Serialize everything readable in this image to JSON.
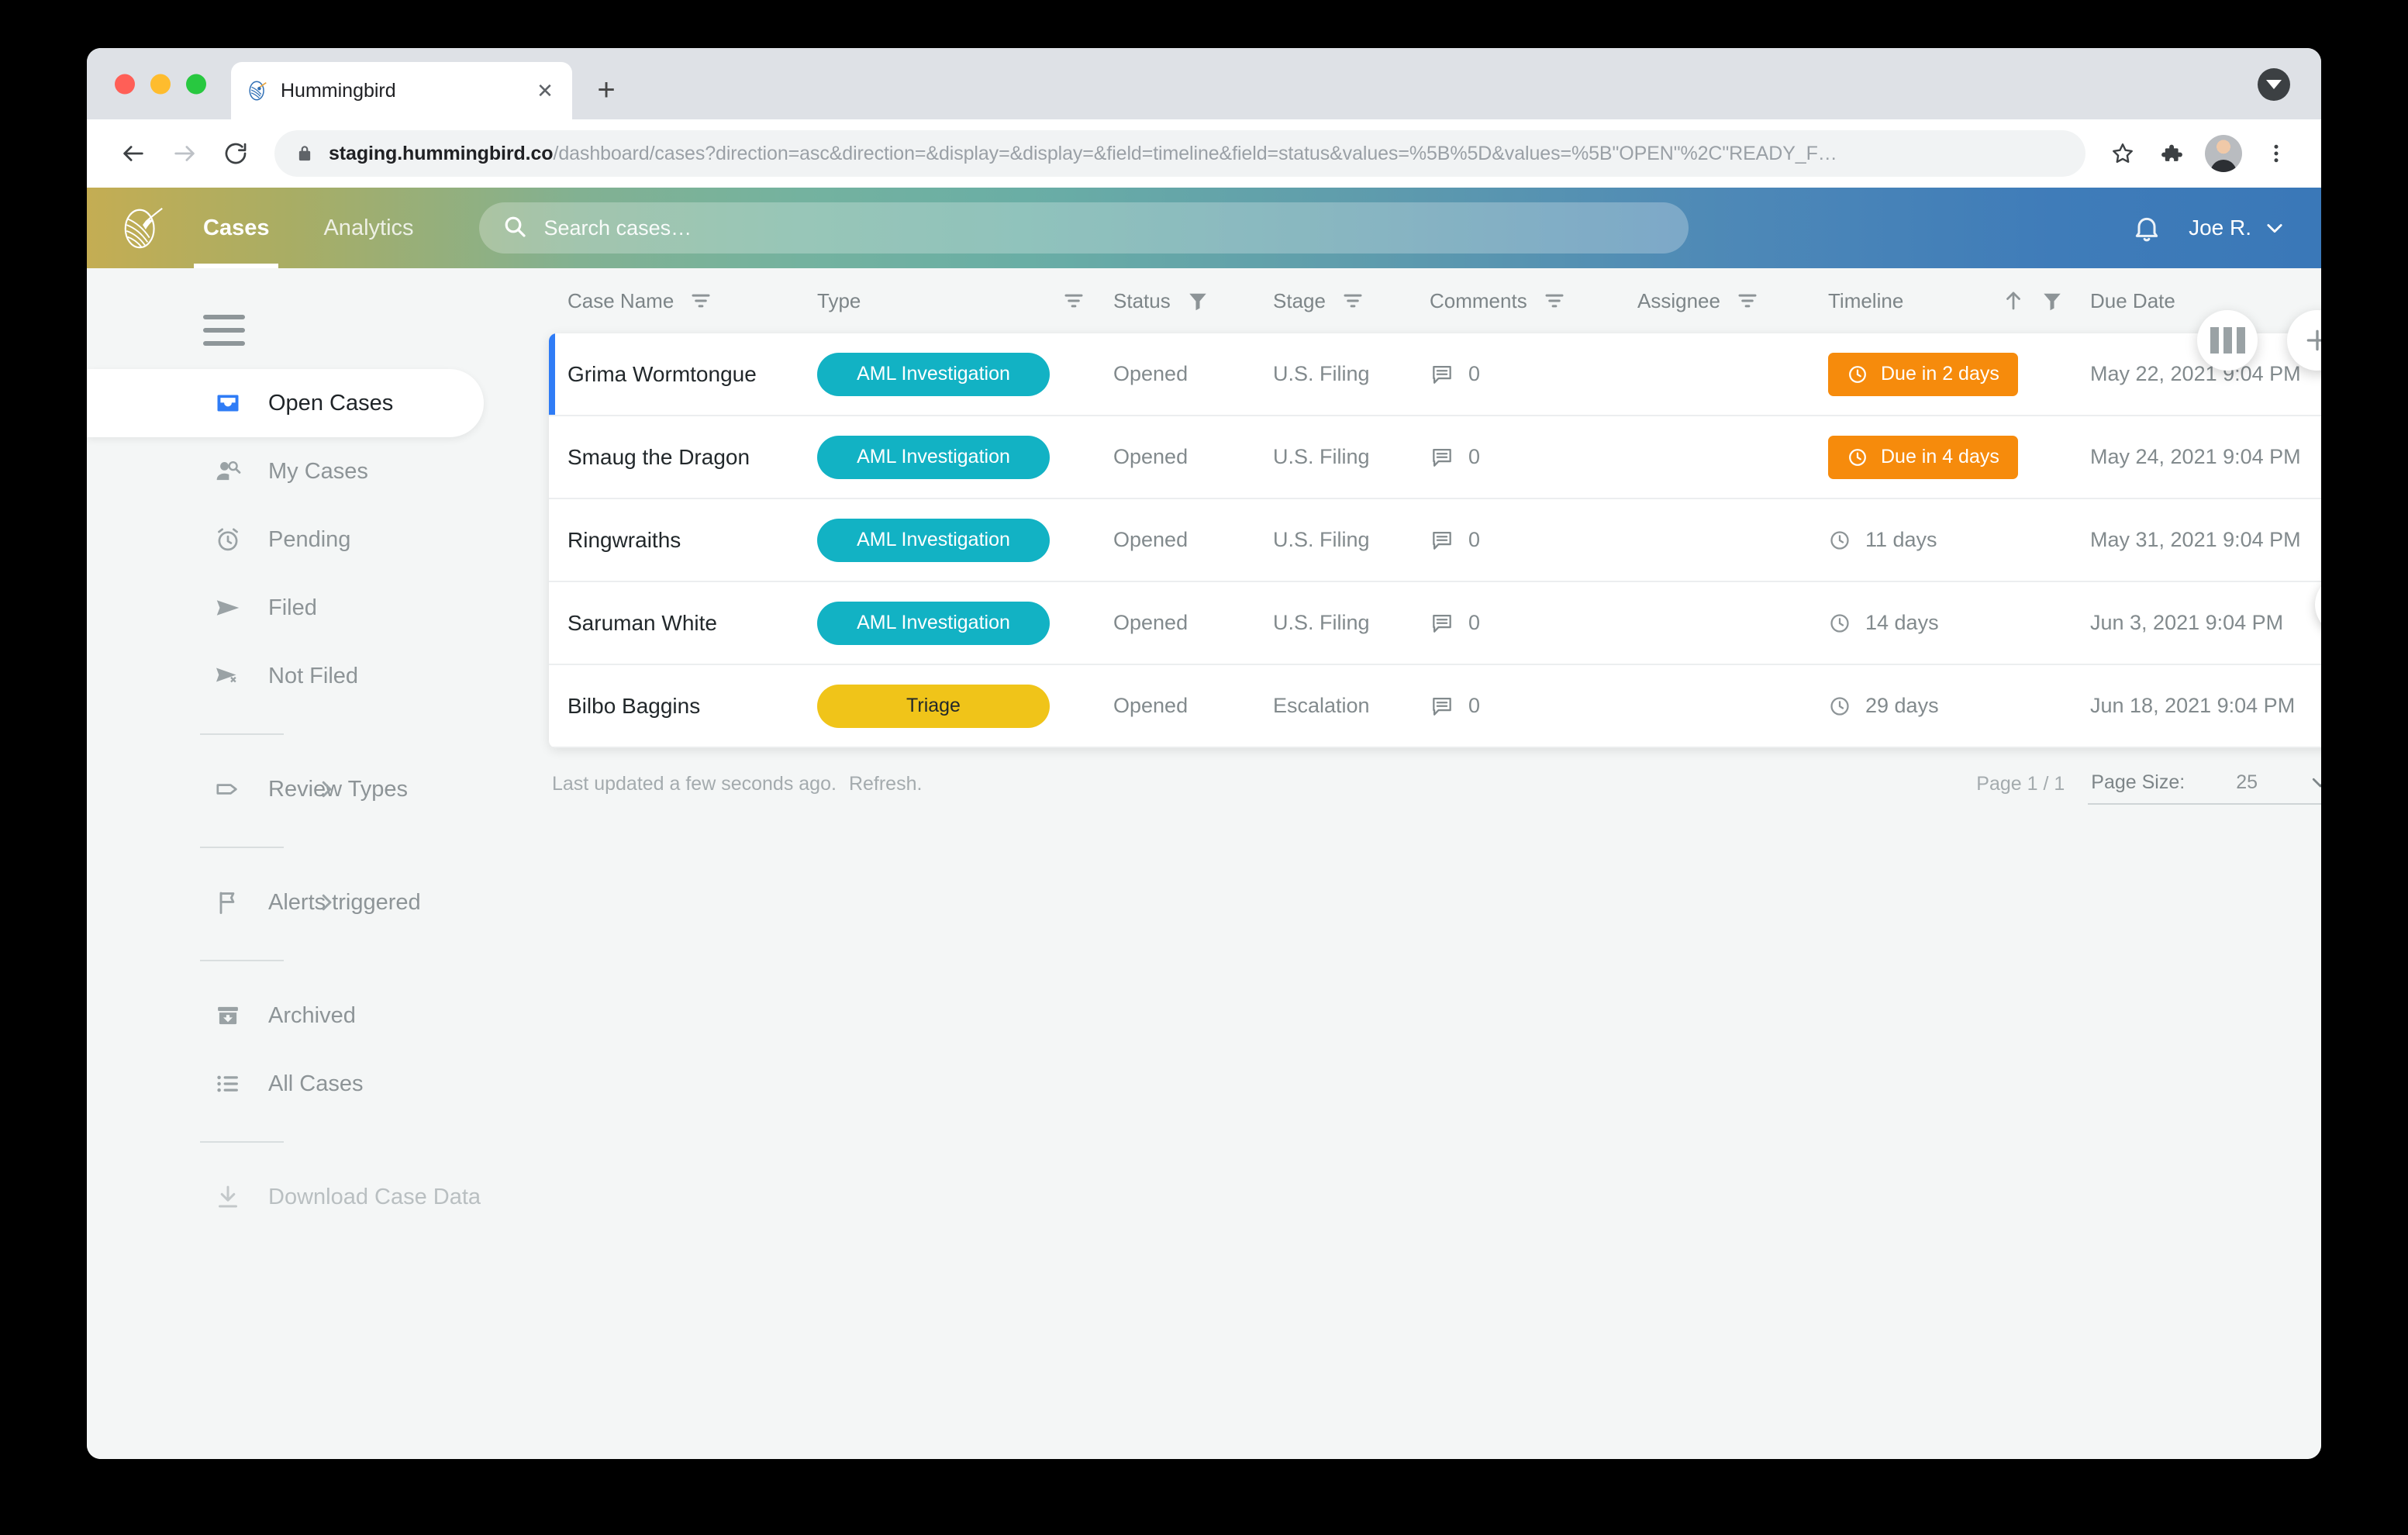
{
  "browser": {
    "tab": {
      "title": "Hummingbird",
      "favicon_icon": "hummingbird-favicon",
      "close_icon": "close-icon"
    },
    "new_tab_icon": "plus-icon",
    "tabstrip_menu_icon": "chevron-down-circle-icon",
    "back_icon": "arrow-left-icon",
    "forward_icon": "arrow-right-icon",
    "reload_icon": "reload-icon",
    "lock_icon": "lock-icon",
    "url_domain": "staging.hummingbird.co",
    "url_path": "/dashboard/cases?direction=asc&direction=&display=&display=&field=timeline&field=status&values=%5B%5D&values=%5B\"OPEN\"%2C\"READY_F…",
    "bookmark_icon": "star-icon",
    "extensions_icon": "puzzle-piece-icon",
    "avatar_name": "profile-avatar",
    "menu_icon": "three-dot-menu-icon"
  },
  "header": {
    "logo_icon": "hummingbird-logo",
    "nav": [
      {
        "label": "Cases",
        "active": true
      },
      {
        "label": "Analytics",
        "active": false
      }
    ],
    "search": {
      "placeholder": "Search cases…",
      "value": "",
      "icon": "search-icon"
    },
    "bell_icon": "bell-icon",
    "user": {
      "label": "Joe R.",
      "caret_icon": "chevron-down-icon"
    }
  },
  "sidebar": {
    "hamburger_icon": "hamburger-icon",
    "items": [
      {
        "label": "Open Cases",
        "icon": "inbox-icon",
        "active": true,
        "muted": false,
        "chevron": false
      },
      {
        "label": "My Cases",
        "icon": "person-search-icon",
        "active": false,
        "muted": false,
        "chevron": false
      },
      {
        "label": "Pending",
        "icon": "alarm-clock-icon",
        "active": false,
        "muted": false,
        "chevron": false
      },
      {
        "label": "Filed",
        "icon": "send-icon",
        "active": false,
        "muted": false,
        "chevron": false
      },
      {
        "label": "Not Filed",
        "icon": "send-off-icon",
        "active": false,
        "muted": false,
        "chevron": false
      },
      {
        "label": "Review Types",
        "icon": "tag-icon",
        "active": false,
        "muted": false,
        "chevron": true
      },
      {
        "label": "Alerts triggered",
        "icon": "flag-icon",
        "active": false,
        "muted": false,
        "chevron": true
      },
      {
        "label": "Archived",
        "icon": "archive-icon",
        "active": false,
        "muted": false,
        "chevron": false
      },
      {
        "label": "All Cases",
        "icon": "list-icon",
        "active": false,
        "muted": false,
        "chevron": false
      },
      {
        "label": "Download Case Data",
        "icon": "download-icon",
        "active": false,
        "muted": true,
        "chevron": false
      }
    ]
  },
  "fabs": [
    {
      "name": "columns-button",
      "icon": "columns-icon"
    },
    {
      "name": "add-case-button",
      "icon": "plus-icon"
    }
  ],
  "table": {
    "columns": [
      {
        "key": "name",
        "label": "Case Name",
        "filter": "outline",
        "sort": "none"
      },
      {
        "key": "type",
        "label": "Type",
        "filter": "outline",
        "sort": "none"
      },
      {
        "key": "status",
        "label": "Status",
        "filter": "active",
        "sort": "none"
      },
      {
        "key": "stage",
        "label": "Stage",
        "filter": "outline",
        "sort": "none"
      },
      {
        "key": "comments",
        "label": "Comments",
        "filter": "outline",
        "sort": "none"
      },
      {
        "key": "assignee",
        "label": "Assignee",
        "filter": "outline",
        "sort": "none"
      },
      {
        "key": "timeline",
        "label": "Timeline",
        "filter": "active",
        "sort": "asc"
      },
      {
        "key": "due",
        "label": "Due Date",
        "filter": "outline",
        "sort": "none"
      }
    ],
    "rows": [
      {
        "selected": true,
        "name": "Grima Wormtongue",
        "type": "AML Investigation",
        "type_color": "#12b2c4",
        "status": "Opened",
        "stage": "U.S. Filing",
        "comments": "0",
        "assignee": "",
        "timeline": "Due in 2 days",
        "timeline_style": "badge",
        "timeline_color": "#f68b0c",
        "due": "May 22, 2021 9:04 PM"
      },
      {
        "selected": false,
        "name": "Smaug the Dragon",
        "type": "AML Investigation",
        "type_color": "#12b2c4",
        "status": "Opened",
        "stage": "U.S. Filing",
        "comments": "0",
        "assignee": "",
        "timeline": "Due in 4 days",
        "timeline_style": "badge",
        "timeline_color": "#f68b0c",
        "due": "May 24, 2021 9:04 PM"
      },
      {
        "selected": false,
        "name": "Ringwraiths",
        "type": "AML Investigation",
        "type_color": "#12b2c4",
        "status": "Opened",
        "stage": "U.S. Filing",
        "comments": "0",
        "assignee": "",
        "timeline": "11 days",
        "timeline_style": "plain",
        "timeline_color": "",
        "due": "May 31, 2021 9:04 PM"
      },
      {
        "selected": false,
        "name": "Saruman White",
        "type": "AML Investigation",
        "type_color": "#12b2c4",
        "status": "Opened",
        "stage": "U.S. Filing",
        "comments": "0",
        "assignee": "",
        "timeline": "14 days",
        "timeline_style": "plain",
        "timeline_color": "",
        "due": "Jun 3, 2021 9:04 PM"
      },
      {
        "selected": false,
        "name": "Bilbo Baggins",
        "type": "Triage",
        "type_color": "#f0c419",
        "status": "Opened",
        "stage": "Escalation",
        "comments": "0",
        "assignee": "",
        "timeline": "29 days",
        "timeline_style": "plain",
        "timeline_color": "",
        "due": "Jun 18, 2021 9:04 PM"
      }
    ],
    "next_page_icon": "chevron-right-icon"
  },
  "footer": {
    "last_updated": "Last updated a few seconds ago.",
    "refresh_label": "Refresh.",
    "page_indicator": "Page 1 / 1",
    "page_size_label": "Page Size:",
    "page_size_value": "25",
    "page_size_caret_icon": "chevron-down-icon"
  },
  "colors": {
    "accent_blue": "#2f7cf6",
    "badge_teal": "#12b2c4",
    "badge_yellow": "#f0c419",
    "badge_orange": "#f68b0c",
    "header_gradient_start": "#c4ad53",
    "header_gradient_end": "#3a78b8"
  }
}
